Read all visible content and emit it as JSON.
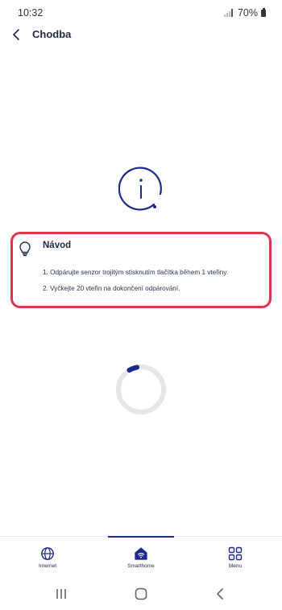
{
  "status_bar": {
    "time": "10:32",
    "battery": "70%"
  },
  "header": {
    "title": "Chodba"
  },
  "guide": {
    "title": "Návod",
    "steps": [
      "1. Odpárujte senzor trojitým stisknutím tlačítka během 1 vteřiny.",
      "2. Vyčkejte 20 vteřin na dokončení odpárování."
    ]
  },
  "bottom_nav": {
    "items": [
      {
        "label": "Internet",
        "icon": "globe-icon"
      },
      {
        "label": "Smarthome",
        "icon": "home-wifi-icon",
        "active": true
      },
      {
        "label": "Menu",
        "icon": "grid-icon"
      }
    ]
  },
  "colors": {
    "accent": "#1a2a8c",
    "highlight_border": "#e0344e",
    "text": "#1f2a44"
  }
}
